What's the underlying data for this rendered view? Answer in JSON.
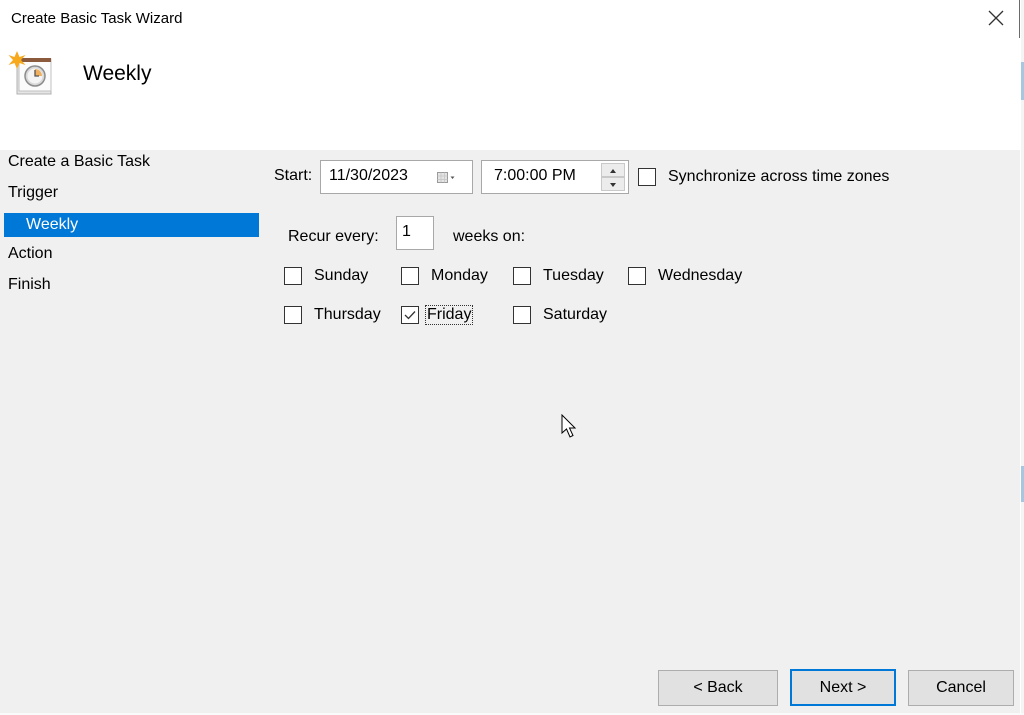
{
  "window": {
    "title": "Create Basic Task Wizard",
    "close_icon": "close-icon"
  },
  "header": {
    "title": "Weekly",
    "icon": "scheduled-task-clock-icon"
  },
  "nav": {
    "items": [
      {
        "label": "Create a Basic Task",
        "selected": false
      },
      {
        "label": "Trigger",
        "selected": false
      },
      {
        "label": "Weekly",
        "selected": true
      },
      {
        "label": "Action",
        "selected": false
      },
      {
        "label": "Finish",
        "selected": false
      }
    ]
  },
  "form": {
    "start_label": "Start:",
    "start_date": "11/30/2023",
    "calendar_icon": "calendar-dropdown-icon",
    "start_time": "7:00:00 PM",
    "sync_label": "Synchronize across time zones",
    "sync_checked": false,
    "recur_label": "Recur every:",
    "recur_value": "1",
    "weeks_on_label": "weeks on:",
    "days": [
      {
        "label": "Sunday",
        "checked": false
      },
      {
        "label": "Monday",
        "checked": false
      },
      {
        "label": "Tuesday",
        "checked": false
      },
      {
        "label": "Wednesday",
        "checked": false
      },
      {
        "label": "Thursday",
        "checked": false
      },
      {
        "label": "Friday",
        "checked": true,
        "focused": true
      },
      {
        "label": "Saturday",
        "checked": false
      }
    ]
  },
  "buttons": {
    "back": "< Back",
    "next": "Next >",
    "cancel": "Cancel"
  },
  "colors": {
    "accent": "#0078d7",
    "panel_bg": "#f0f0f0"
  }
}
